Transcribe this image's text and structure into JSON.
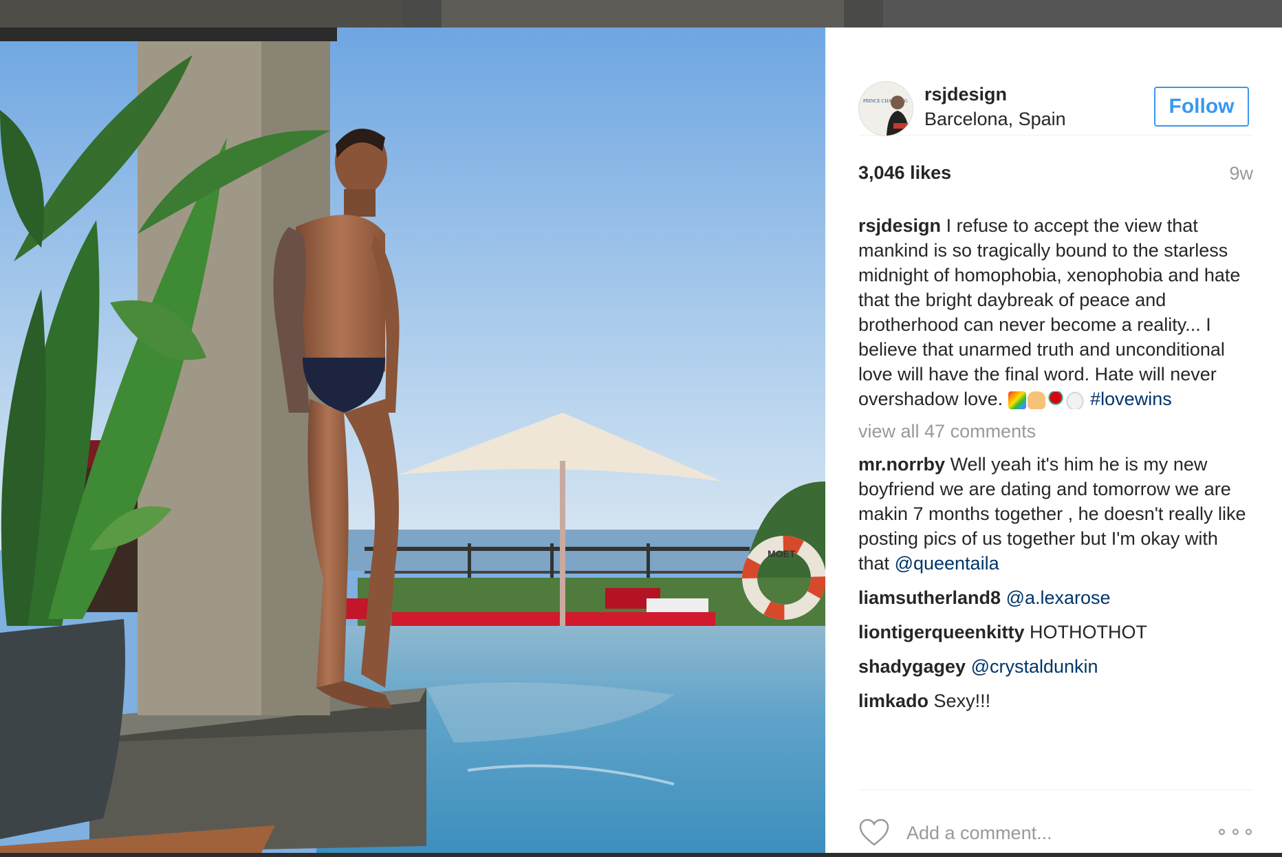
{
  "post": {
    "username": "rsjdesign",
    "location": "Barcelona, Spain",
    "follow_label": "Follow",
    "likes": "3,046 likes",
    "time": "9w",
    "avatar_text": "PRINCE CHARMING"
  },
  "caption": {
    "username": "rsjdesign",
    "text": "I refuse to accept the view that mankind is so tragically bound to the starless midnight of homophobia, xenophobia and hate that the bright daybreak of peace and brotherhood can never become a reality... I believe that unarmed truth and unconditional love will have the final word. Hate will never overshadow love.",
    "hashtag": "#lovewins",
    "emojis": [
      "rainbow-emoji",
      "praying-hands-emoji",
      "rose-emoji",
      "dove-emoji"
    ]
  },
  "view_all": "view all 47 comments",
  "comments": [
    {
      "user": "mr.norrby",
      "text": "Well yeah it's him he is my new boyfriend we are dating and tomorrow we are makin 7 months together , he doesn't really like posting pics of us together but I'm okay with that",
      "mention": "@queentaila"
    },
    {
      "user": "liamsutherland8",
      "text": "",
      "mention": "@a.lexarose"
    },
    {
      "user": "liontigerqueenkitty",
      "text": "HOTHOTHOT",
      "mention": ""
    },
    {
      "user": "shadygagey",
      "text": "",
      "mention": "@crystaldunkin"
    },
    {
      "user": "limkado",
      "text": "Sexy!!!",
      "mention": ""
    }
  ],
  "footer": {
    "comment_placeholder": "Add a comment..."
  },
  "photo": {
    "ring_text": "MOET",
    "icon": "pool-photo"
  },
  "colors": {
    "follow_blue": "#3897f0",
    "mention_blue": "#003569",
    "muted_gray": "#999999"
  }
}
